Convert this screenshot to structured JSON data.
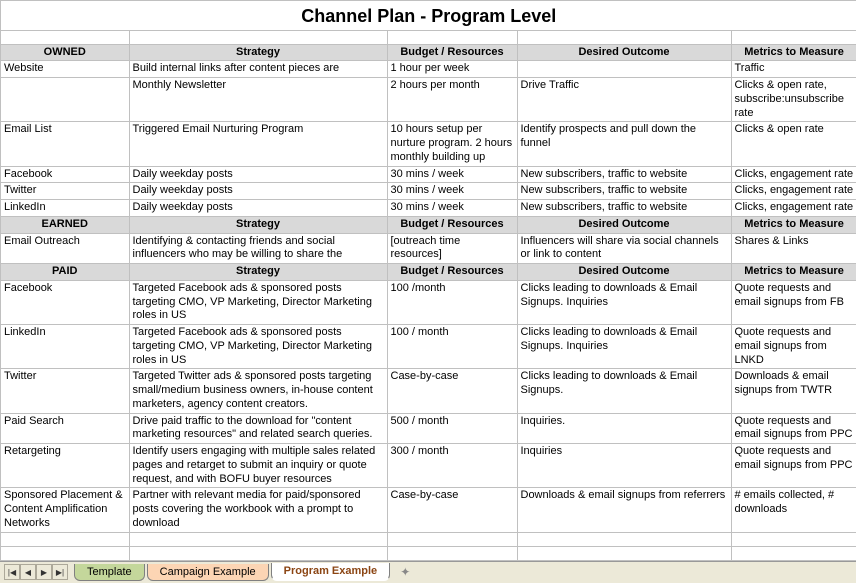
{
  "title": "Channel Plan - Program Level",
  "columns": {
    "strategy": "Strategy",
    "budget": "Budget / Resources",
    "outcome": "Desired Outcome",
    "metrics": "Metrics to Measure"
  },
  "sections": [
    {
      "name": "OWNED",
      "rows": [
        {
          "channel": "Website",
          "strategy": "Build internal links after content pieces are",
          "budget": "1 hour per week",
          "outcome": "",
          "metrics": "Traffic"
        },
        {
          "channel": "",
          "strategy": "Monthly Newsletter",
          "budget": "2 hours per month",
          "outcome": "Drive Traffic",
          "metrics": "Clicks & open rate, subscribe:unsubscribe rate"
        },
        {
          "channel": "Email List",
          "strategy": "Triggered Email Nurturing Program",
          "budget": "10 hours setup per nurture program. 2 hours monthly building up",
          "outcome": "Identify prospects and pull down the funnel",
          "metrics": "Clicks & open rate"
        },
        {
          "channel": "Facebook",
          "strategy": "Daily weekday posts",
          "budget": "30 mins / week",
          "outcome": "New subscribers, traffic to website",
          "metrics": "Clicks, engagement rate"
        },
        {
          "channel": "Twitter",
          "strategy": "Daily weekday posts",
          "budget": "30 mins / week",
          "outcome": "New subscribers, traffic to website",
          "metrics": "Clicks, engagement rate"
        },
        {
          "channel": "LinkedIn",
          "strategy": "Daily weekday posts",
          "budget": "30 mins / week",
          "outcome": "New subscribers, traffic to website",
          "metrics": "Clicks, engagement rate"
        }
      ]
    },
    {
      "name": "EARNED",
      "rows": [
        {
          "channel": "Email Outreach",
          "strategy": "Identifying & contacting friends and social influencers who may be willing to share the",
          "budget": "[outreach time resources]",
          "outcome": "Influencers will share via social channels or link to content",
          "metrics": "Shares & Links"
        }
      ]
    },
    {
      "name": "PAID",
      "rows": [
        {
          "channel": "Facebook",
          "strategy": "Targeted Facebook ads & sponsored posts targeting CMO, VP Marketing, Director Marketing roles in US",
          "budget": "100 /month",
          "outcome": "Clicks leading to downloads & Email Signups. Inquiries",
          "metrics": "Quote requests and email signups from FB"
        },
        {
          "channel": "LinkedIn",
          "strategy": "Targeted Facebook ads & sponsored posts targeting CMO, VP Marketing, Director Marketing roles in US",
          "budget": "100 / month",
          "outcome": "Clicks leading to downloads & Email Signups. Inquiries",
          "metrics": "Quote requests and email signups from LNKD"
        },
        {
          "channel": "Twitter",
          "strategy": "Targeted Twitter ads & sponsored posts targeting small/medium business owners, in-house content marketers, agency content creators.",
          "budget": "Case-by-case",
          "outcome": "Clicks leading to downloads & Email Signups.",
          "metrics": "Downloads & email signups from TWTR"
        },
        {
          "channel": "Paid Search",
          "strategy": "Drive paid traffic to the download for \"content marketing resources\" and related search queries.",
          "budget": "500 / month",
          "outcome": "Inquiries.",
          "metrics": "Quote requests and email signups from PPC"
        },
        {
          "channel": "Retargeting",
          "strategy": "Identify users engaging with multiple sales related pages and retarget to submit an inquiry or quote request, and with BOFU buyer resources",
          "budget": "300 / month",
          "outcome": "Inquiries",
          "metrics": "Quote requests and email signups from PPC"
        },
        {
          "channel": "Sponsored Placement & Content Amplification Networks",
          "strategy": "Partner with relevant media for paid/sponsored posts covering the workbook with a prompt to download",
          "budget": "Case-by-case",
          "outcome": "Downloads & email signups from referrers",
          "metrics": "# emails collected, # downloads"
        }
      ]
    }
  ],
  "tabs": {
    "template": "Template",
    "campaign": "Campaign Example",
    "program": "Program Example"
  },
  "nav": {
    "first": "|◀",
    "prev": "◀",
    "next": "▶",
    "last": "▶|"
  }
}
